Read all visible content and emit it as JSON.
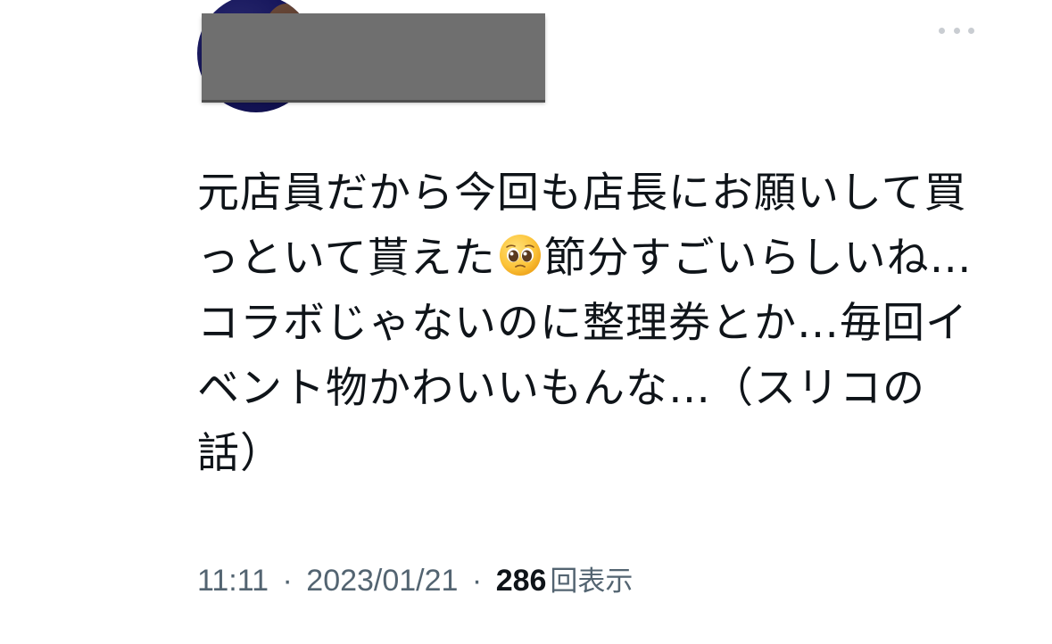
{
  "tweet": {
    "text_part1": "元店員だから今回も店長にお願いして買っといて貰えた",
    "emoji_icon": "pleading-face-emoji",
    "text_part2": "節分すごいらしいね…コラボじゃないのに整理券とか…毎回イベント物かわいいもんな…（スリコの話）",
    "time": "11:11",
    "date": "2023/01/21",
    "separator": "·",
    "views_count": "286",
    "views_label": "回表示",
    "more_icon": "more-horizontal-icon"
  },
  "colors": {
    "text_primary": "#0f1419",
    "text_secondary": "#536471",
    "redaction": "#6f6f6f",
    "dots": "#c9cdd2"
  }
}
